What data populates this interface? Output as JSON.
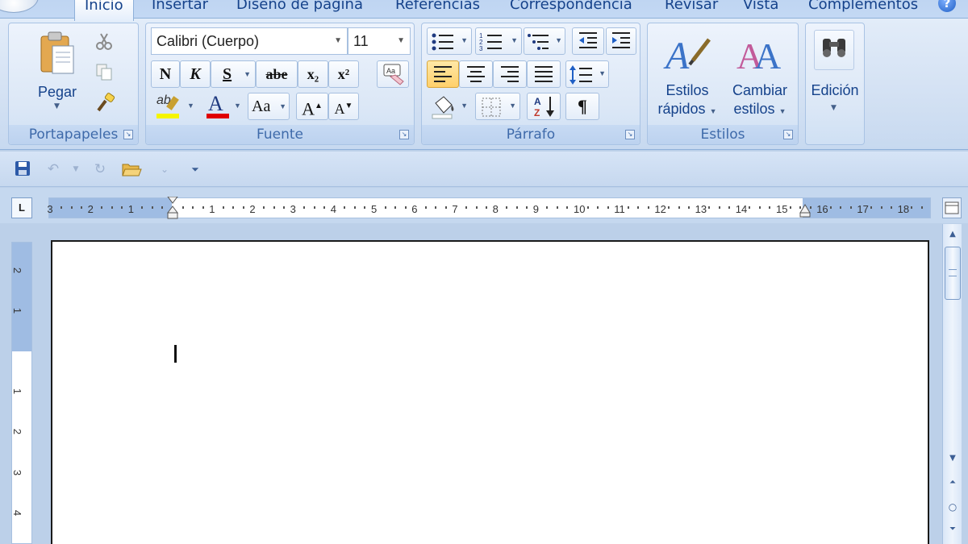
{
  "tabs": [
    {
      "label": "Inicio",
      "active": true
    },
    {
      "label": "Insertar"
    },
    {
      "label": "Diseño de página"
    },
    {
      "label": "Referencias"
    },
    {
      "label": "Correspondencia"
    },
    {
      "label": "Revisar"
    },
    {
      "label": "Vista"
    },
    {
      "label": "Complementos"
    }
  ],
  "help": {
    "label": "?"
  },
  "ribbon": {
    "clipboard": {
      "group_label": "Portapapeles",
      "paste_label": "Pegar"
    },
    "font": {
      "group_label": "Fuente",
      "font_name": "Calibri (Cuerpo)",
      "font_size": "11",
      "bold": "N",
      "italic": "K",
      "underline": "S",
      "strikethrough": "abe",
      "subscript": "x₂",
      "superscript": "x²",
      "change_case": "Aa",
      "grow_font": "A",
      "shrink_font": "A",
      "highlight_label": "ab"
    },
    "paragraph": {
      "group_label": "Párrafo",
      "show_marks": "¶"
    },
    "styles": {
      "group_label": "Estilos",
      "quick_styles_line1": "Estilos",
      "quick_styles_line2": "rápidos",
      "change_styles_line1": "Cambiar",
      "change_styles_line2": "estilos"
    },
    "editing": {
      "label": "Edición"
    }
  },
  "ruler": {
    "tab_selector": "L",
    "horizontal_ticks_left": [
      "3",
      "2",
      "1"
    ],
    "horizontal_ticks": [
      "1",
      "2",
      "3",
      "4",
      "5",
      "6",
      "7",
      "8",
      "9",
      "10",
      "11",
      "12",
      "13",
      "14",
      "15"
    ],
    "horizontal_ticks_right": [
      "16",
      "17",
      "18"
    ],
    "vertical_ticks_top": [
      "2",
      "1"
    ],
    "vertical_ticks": [
      "1",
      "2",
      "3",
      "4"
    ]
  },
  "icons": {
    "save": "save-icon",
    "undo": "undo-icon",
    "redo": "redo-icon",
    "open": "open-folder-icon",
    "cut": "scissors-icon",
    "copy": "copy-icon",
    "format_painter": "brush-icon",
    "find": "binoculars-icon"
  },
  "colors": {
    "ribbon_text": "#15428b",
    "highlight_yellow": "#f5f500",
    "font_red": "#e00000",
    "selected_button": "#ffd06b"
  }
}
